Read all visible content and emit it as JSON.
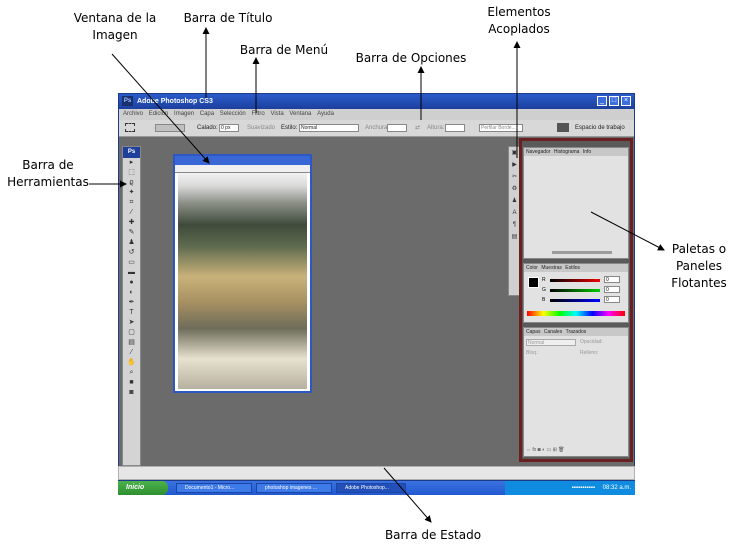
{
  "annotations": {
    "ventana_imagen": [
      "Ventana de la",
      "Imagen"
    ],
    "barra_titulo": "Barra de Título",
    "barra_menu": "Barra de Menú",
    "barra_opciones": "Barra de Opciones",
    "elementos_acoplados": [
      "Elementos",
      "Acoplados"
    ],
    "barra_herramientas": [
      "Barra de",
      "Herramientas"
    ],
    "paletas": [
      "Paletas o",
      "Paneles",
      "Flotantes"
    ],
    "barra_estado": "Barra de Estado"
  },
  "app": {
    "title": "Adobe Photoshop CS3",
    "logo": "Ps",
    "menu": [
      "Archivo",
      "Edición",
      "Imagen",
      "Capa",
      "Selección",
      "Filtro",
      "Vista",
      "Ventana",
      "Ayuda"
    ],
    "options": {
      "calado_label": "Calado:",
      "calado_value": "0 px",
      "suavizado": "Suavizado",
      "estilo_label": "Estilo:",
      "estilo_value": "Normal",
      "anchura_label": "Anchura:",
      "altura_label": "Altura:",
      "refine_button": "Perfilar Borde...",
      "workspace": "Espacio de trabajo"
    },
    "panels": {
      "navigator_tabs": [
        "Navegador",
        "Histograma",
        "Info"
      ],
      "color_tabs": [
        "Color",
        "Muestras",
        "Estilos"
      ],
      "color_values": [
        "0",
        "0",
        "0"
      ],
      "color_letters": [
        "R",
        "G",
        "B"
      ],
      "layers_tabs": [
        "Capas",
        "Canales",
        "Trazados"
      ],
      "layers_mode": "Normal",
      "layers_opacity_label": "Opacidad:",
      "layers_lock_label": "Bloq.:",
      "layers_fill_label": "Relleno:"
    },
    "taskbar": {
      "start": "Inicio",
      "tasks": [
        "Documento1 - Micro...",
        "photoshop imagenes ...",
        "Adobe Photoshop..."
      ],
      "clock": "08:32 a.m."
    }
  },
  "colors": {
    "xp_blue": "#2a5cc9",
    "panel_border": "#6a2020",
    "workspace": "#6b6b6b"
  }
}
